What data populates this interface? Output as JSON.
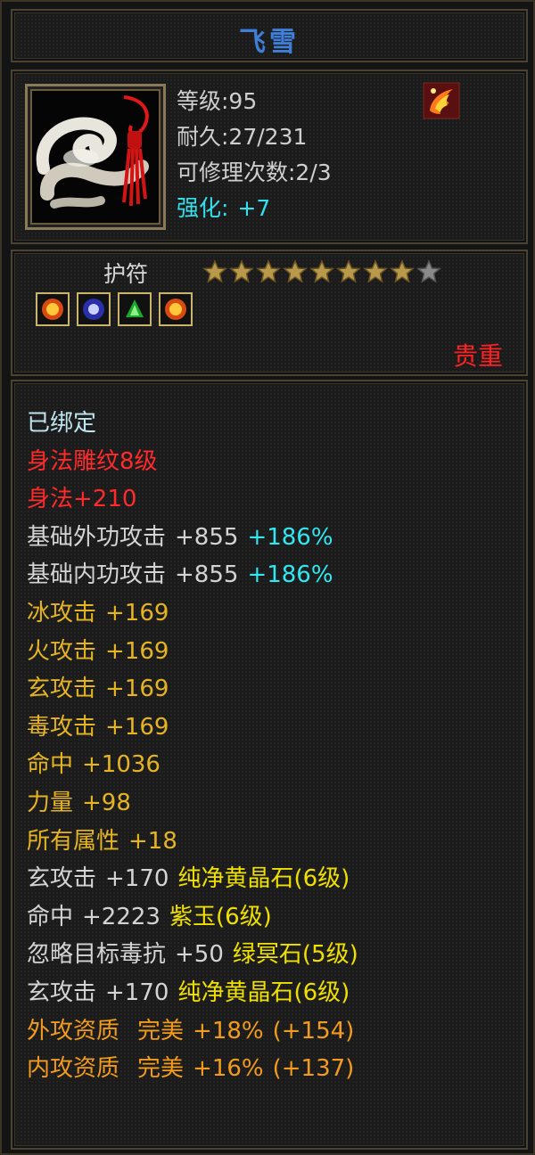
{
  "title": "飞雪",
  "stats": {
    "level": "等级:95",
    "durability": "耐久:27/231",
    "repairs": "可修理次数:2/3",
    "enhance_label": "强化:",
    "enhance_value": "+7"
  },
  "sub": {
    "type_label": "护符",
    "stars_filled": 8,
    "stars_total": 9,
    "rarity": "贵重"
  },
  "icons": {
    "item": "jade-amulet-icon",
    "corner": "phoenix-flame-icon",
    "gems": [
      "sun-gem-icon",
      "moon-gem-icon",
      "leaf-gem-icon",
      "sun-gem-icon"
    ]
  },
  "colors": {
    "title": "#3f7fd8",
    "red": "#ff2a2a",
    "gold": "#e6b422",
    "cyan": "#2fe8f2",
    "yellow": "#f0e000",
    "orange": "#f29b1c"
  },
  "attributes": {
    "bound": "已绑定",
    "engrave": "身法雕纹8级",
    "agility": "身法+210",
    "ext_attack": {
      "label": "基础外功攻击",
      "value": "+855",
      "pct": "+186%"
    },
    "int_attack": {
      "label": "基础内功攻击",
      "value": "+855",
      "pct": "+186%"
    },
    "ice": {
      "label": "冰攻击",
      "value": "+169"
    },
    "fire": {
      "label": "火攻击",
      "value": "+169"
    },
    "mystic": {
      "label": "玄攻击",
      "value": "+169"
    },
    "poison": {
      "label": "毒攻击",
      "value": "+169"
    },
    "hit": {
      "label": "命中",
      "value": "+1036"
    },
    "strength": {
      "label": "力量",
      "value": "+98"
    },
    "all": {
      "label": "所有属性",
      "value": "+18"
    },
    "gem1": {
      "label": "玄攻击",
      "value": "+170",
      "gem": "纯净黄晶石(6级)"
    },
    "gem2": {
      "label": "命中",
      "value": "+2223",
      "gem": "紫玉(6级)"
    },
    "gem3": {
      "label": "忽略目标毒抗",
      "value": "+50",
      "gem": "绿冥石(5级)"
    },
    "gem4": {
      "label": "玄攻击",
      "value": "+170",
      "gem": "纯净黄晶石(6级)"
    },
    "apt1": {
      "label": "外攻资质",
      "quality": "完美",
      "pct": "+18%",
      "bonus": "(+154)"
    },
    "apt2": {
      "label": "内攻资质",
      "quality": "完美",
      "pct": "+16%",
      "bonus": "(+137)"
    }
  }
}
